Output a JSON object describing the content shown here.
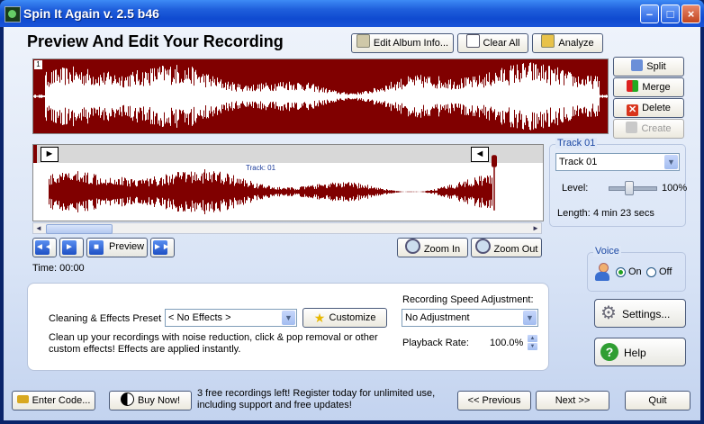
{
  "window": {
    "title": "Spin It Again v. 2.5 b46"
  },
  "header": {
    "title": "Preview And Edit Your Recording"
  },
  "toolbar": {
    "edit_album_label": "Edit Album Info...",
    "clear_all_label": "Clear All",
    "analyze_label": "Analyze"
  },
  "side_actions": {
    "split_label": "Split",
    "merge_label": "Merge",
    "delete_label": "Delete",
    "create_label": "Create"
  },
  "waveform": {
    "marker": "1",
    "track_label": "Track: 01",
    "wave_color": "#800000"
  },
  "transport": {
    "preview_label": "Preview",
    "zoom_in_label": "Zoom In",
    "zoom_out_label": "Zoom Out",
    "time_label": "Time: 00:00"
  },
  "track_panel": {
    "title": "Track 01",
    "selected_track": "Track 01",
    "level_label": "Level:",
    "level_value": "100%",
    "level_fraction": 0.4,
    "length_label": "Length:",
    "length_value": "4 min 23 secs"
  },
  "voice_panel": {
    "title": "Voice",
    "on_label": "On",
    "off_label": "Off",
    "selected": "On"
  },
  "effects": {
    "preset_label": "Cleaning & Effects Preset :",
    "preset_value": "< No Effects >",
    "customize_label": "Customize",
    "description": "Clean up your recordings with noise reduction, click & pop removal or other custom effects!  Effects are applied instantly.",
    "speed_label": "Recording Speed Adjustment:",
    "speed_value": "No Adjustment",
    "playback_label": "Playback Rate:",
    "playback_value": "100.0%"
  },
  "settings_label": "Settings...",
  "help_label": "Help",
  "footer": {
    "enter_code_label": "Enter Code...",
    "buy_now_label": "Buy Now!",
    "message": "3 free recordings left!  Register today for unlimited use, including support and free updates!",
    "previous_label": "<< Previous",
    "next_label": "Next >>",
    "quit_label": "Quit"
  }
}
